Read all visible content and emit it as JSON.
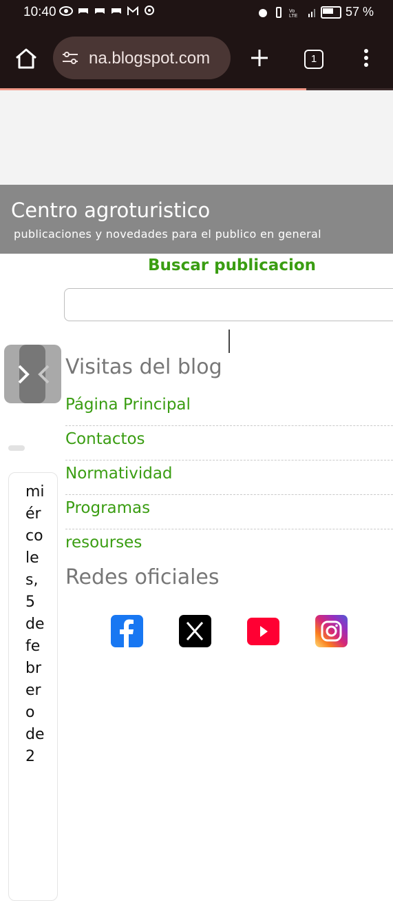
{
  "status": {
    "time": "10:40",
    "battery": "57 %",
    "battery_level": 0.57
  },
  "browser": {
    "url": "na.blogspot.com",
    "tab_count": "1",
    "progress": 0.78
  },
  "blog": {
    "title": "Centro agroturistico",
    "description": "publicaciones y novedades para el publico en general"
  },
  "search": {
    "label": "Buscar publicacion",
    "placeholder": ""
  },
  "sidebar_date": "miércoles, 5 de febrero de 2",
  "visits": {
    "title": "Visitas del blog"
  },
  "pages": [
    {
      "label": "Página Principal"
    },
    {
      "label": "Contactos"
    },
    {
      "label": "Normatividad"
    },
    {
      "label": "Programas"
    },
    {
      "label": "resourses"
    }
  ],
  "social": {
    "title": "Redes oficiales",
    "icons": [
      "facebook-icon",
      "x-icon",
      "youtube-icon",
      "instagram-icon"
    ]
  },
  "colors": {
    "link": "#3a9d12",
    "header_bg": "#888888",
    "browser_bg": "#1f1414"
  }
}
